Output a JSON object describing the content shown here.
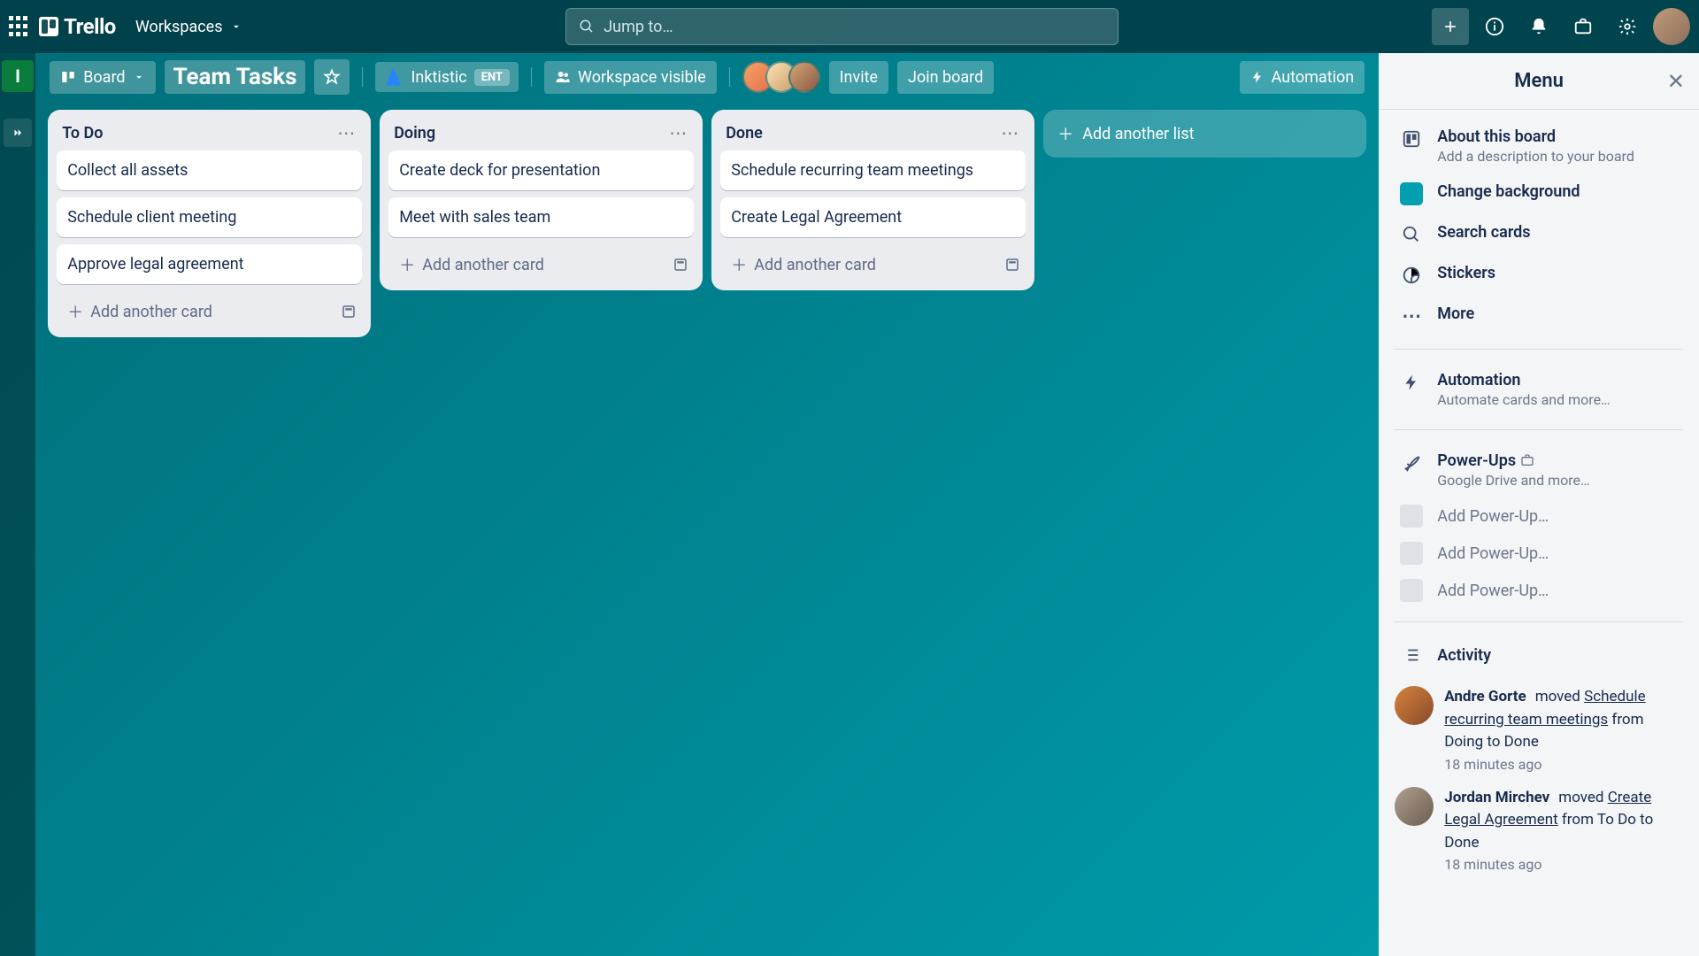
{
  "topnav": {
    "logo": "Trello",
    "workspaces": "Workspaces",
    "search_placeholder": "Jump to…"
  },
  "left_rail": {
    "workspace_letter": "I"
  },
  "board_header": {
    "view_btn": "Board",
    "title": "Team Tasks",
    "org_name": "Inktistic",
    "ent_badge": "ENT",
    "visibility": "Workspace visible",
    "invite": "Invite",
    "join": "Join board",
    "automation": "Automation"
  },
  "lists": [
    {
      "title": "To Do",
      "cards": [
        "Collect all assets",
        "Schedule client meeting",
        "Approve legal agreement"
      ],
      "add_label": "Add another card"
    },
    {
      "title": "Doing",
      "cards": [
        "Create deck for presentation",
        "Meet with sales team"
      ],
      "add_label": "Add another card"
    },
    {
      "title": "Done",
      "cards": [
        "Schedule recurring team meetings",
        "Create Legal Agreement"
      ],
      "add_label": "Add another card"
    }
  ],
  "add_list": "Add another list",
  "side_menu": {
    "title": "Menu",
    "items": {
      "about": {
        "label": "About this board",
        "sub": "Add a description to your board"
      },
      "change_bg": {
        "label": "Change background"
      },
      "search_cards": {
        "label": "Search cards"
      },
      "stickers": {
        "label": "Stickers"
      },
      "more": {
        "label": "More"
      },
      "automation": {
        "label": "Automation",
        "sub": "Automate cards and more…"
      },
      "powerups": {
        "label": "Power-Ups",
        "sub": "Google Drive and more…"
      },
      "add_powerup": "Add Power-Up…"
    },
    "activity_title": "Activity",
    "activity": [
      {
        "user": "Andre Gorte",
        "action": "moved",
        "link": "Schedule recurring team meetings",
        "rest": " from Doing to Done",
        "time": "18 minutes ago"
      },
      {
        "user": "Jordan Mirchev",
        "action": "moved",
        "link": "Create Legal Agreement",
        "rest": " from To Do to Done",
        "time": "18 minutes ago"
      }
    ]
  }
}
